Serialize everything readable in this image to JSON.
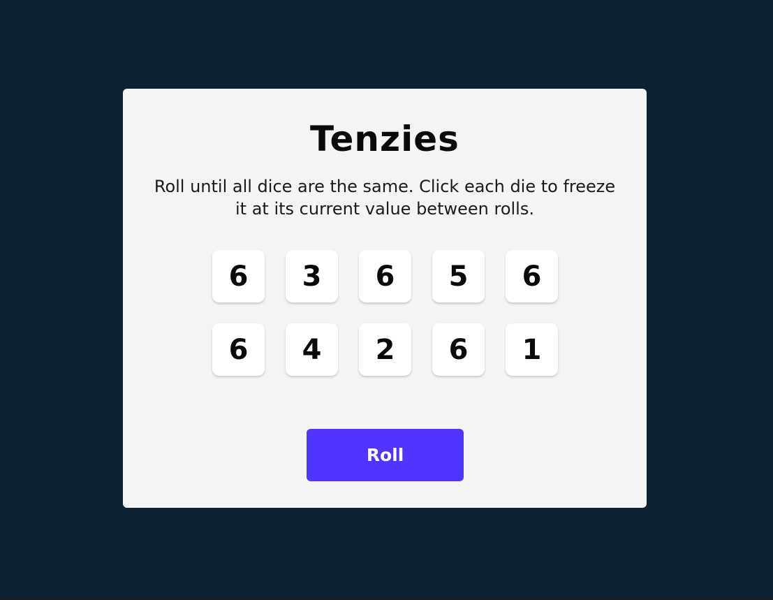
{
  "game": {
    "title": "Tenzies",
    "instructions": "Roll until all dice are the same. Click each die to freeze it at its current value between rolls.",
    "dice": [
      {
        "value": "6"
      },
      {
        "value": "3"
      },
      {
        "value": "6"
      },
      {
        "value": "5"
      },
      {
        "value": "6"
      },
      {
        "value": "6"
      },
      {
        "value": "4"
      },
      {
        "value": "2"
      },
      {
        "value": "6"
      },
      {
        "value": "1"
      }
    ],
    "roll_label": "Roll"
  },
  "colors": {
    "page_background": "#0b2233",
    "card_background": "#f4f4f4",
    "die_background": "#ffffff",
    "button_accent": "#5035ff",
    "button_text": "#ffffff",
    "text": "#0a0a0a"
  }
}
